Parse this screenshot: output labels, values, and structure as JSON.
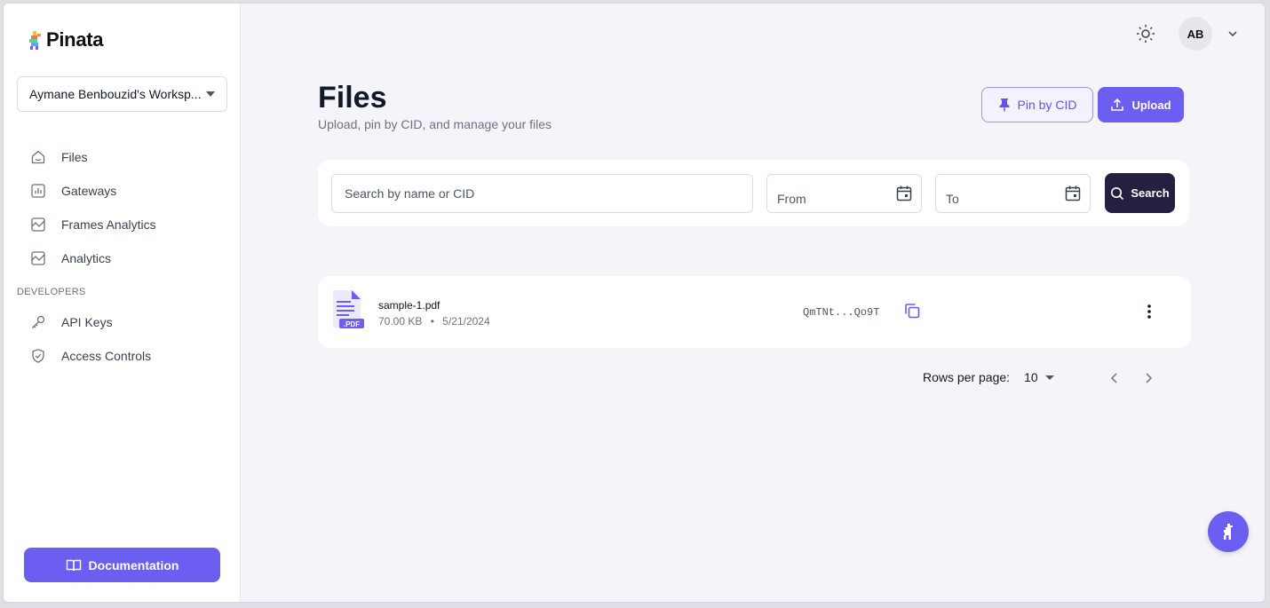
{
  "app": {
    "brand": "Pinata",
    "accent": "#6b5ef0",
    "dark": "#23213f"
  },
  "sidebar": {
    "workspace": "Aymane Benbouzid's Worksp...",
    "items": [
      {
        "label": "Files",
        "icon": "home-icon"
      },
      {
        "label": "Gateways",
        "icon": "bar-chart-icon"
      },
      {
        "label": "Frames Analytics",
        "icon": "trend-chart-icon"
      },
      {
        "label": "Analytics",
        "icon": "trend-chart-icon"
      }
    ],
    "developers_label": "DEVELOPERS",
    "dev_items": [
      {
        "label": "API Keys",
        "icon": "key-icon"
      },
      {
        "label": "Access Controls",
        "icon": "shield-check-icon"
      }
    ],
    "docs_label": "Documentation"
  },
  "header": {
    "avatar_initials": "AB"
  },
  "page": {
    "title": "Files",
    "subtitle": "Upload, pin by CID, and manage your files",
    "pin_label": "Pin by CID",
    "upload_label": "Upload"
  },
  "search": {
    "placeholder": "Search by name or CID",
    "from_label": "From",
    "to_label": "To",
    "button_label": "Search"
  },
  "files": [
    {
      "name": "sample-1.pdf",
      "size": "70.00 KB",
      "date": "5/21/2024",
      "cid": "QmTNt...Qo9T",
      "badge": ".PDF"
    }
  ],
  "pagination": {
    "rows_label": "Rows per page:",
    "rows_value": "10"
  }
}
